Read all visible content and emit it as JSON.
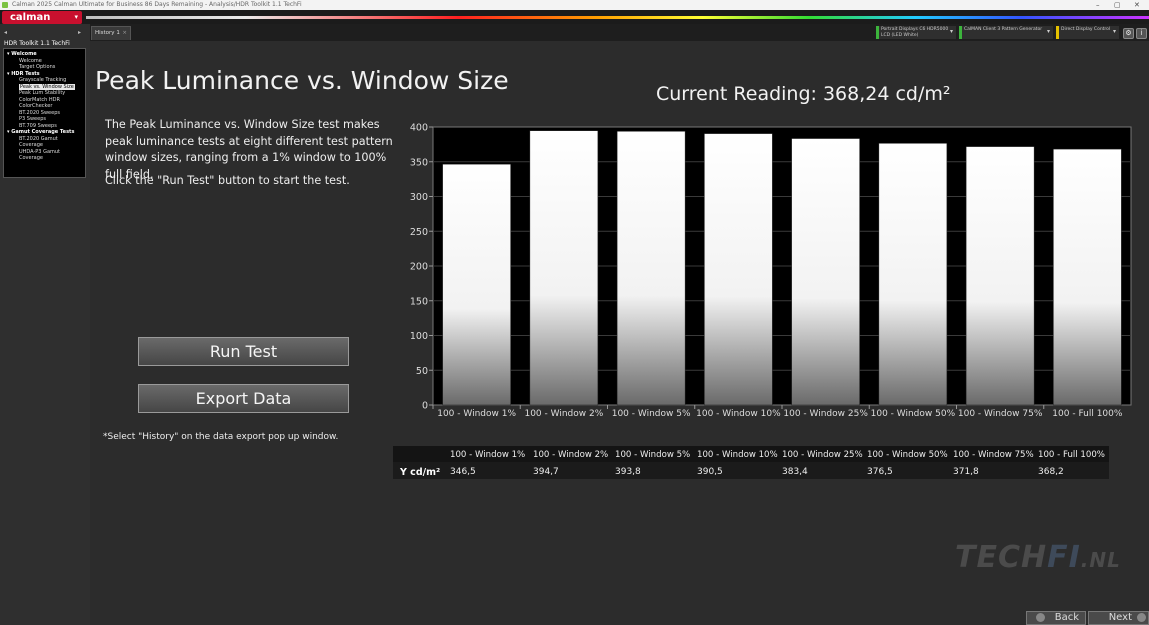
{
  "window": {
    "title": "Calman 2025 Calman Ultimate for Business 86 Days Remaining - Analysis/HDR Toolkit 1.1 TechFi",
    "controls": [
      "–",
      "▢",
      "✕"
    ]
  },
  "app": {
    "logo": "calman",
    "menu_caret": "▾"
  },
  "sidebar": {
    "title": "HDR Toolkit 1.1 TechFi",
    "nav_left": "◂",
    "nav_right": "▸",
    "tree": [
      {
        "label": "Welcome",
        "level": 0
      },
      {
        "label": "Welcome",
        "level": 1
      },
      {
        "label": "Target Options",
        "level": 1
      },
      {
        "label": "HDR Tests",
        "level": 0
      },
      {
        "label": "Grayscale Tracking",
        "level": 1
      },
      {
        "label": "Peak vs. Window Size",
        "level": 1,
        "selected": true
      },
      {
        "label": "Peak Lum Stability",
        "level": 1
      },
      {
        "label": "ColorMatch HDR",
        "level": 1
      },
      {
        "label": "ColorChecker",
        "level": 1
      },
      {
        "label": "BT.2020 Sweeps",
        "level": 1
      },
      {
        "label": "P3 Sweeps",
        "level": 1
      },
      {
        "label": "BT.709 Sweeps",
        "level": 1
      },
      {
        "label": "Gamut Coverage Tests",
        "level": 0
      },
      {
        "label": "BT.2020 Gamut Coverage",
        "level": 1
      },
      {
        "label": "UHDA-P3 Gamut Coverage",
        "level": 1
      }
    ]
  },
  "tabs": {
    "history_label": "History 1",
    "close": "×"
  },
  "devices": {
    "meter": "Portrait Displays C6 HDR5000 LCD (LED White)",
    "generator": "CalMAN Client 3 Pattern Generator",
    "display": "Direct Display Control"
  },
  "main": {
    "title": "Peak Luminance vs. Window Size",
    "current_reading": "Current Reading: 368,24 cd/m²",
    "description": "The Peak Luminance vs. Window Size test makes peak luminance tests at eight different test pattern window sizes, ranging from a 1% window to 100% full field.",
    "instruction": "Click the \"Run Test\" button to start the test.",
    "run_button": "Run Test",
    "export_button": "Export  Data",
    "note": "*Select \"History\" on the data export pop up window."
  },
  "chart_data": {
    "type": "bar",
    "categories": [
      "100 - Window  1%",
      "100 - Window  2%",
      "100 - Window  5%",
      "100 - Window 10%",
      "100 - Window 25%",
      "100 - Window 50%",
      "100 - Window 75%",
      "100 - Full  100%"
    ],
    "values": [
      346.5,
      394.7,
      393.8,
      390.5,
      383.4,
      376.5,
      371.8,
      368.2
    ],
    "ylim": [
      0,
      400
    ],
    "yticks": [
      "0",
      "50",
      "100",
      "150",
      "200",
      "250",
      "300",
      "350",
      "400"
    ],
    "bar_color_top": "#ffffff",
    "bar_color_bottom": "#6a6a6a",
    "plot_background": "#000000"
  },
  "table": {
    "row_label": "Y cd/m²",
    "headers": [
      "100 - Window  1%",
      "100 - Window  2%",
      "100 - Window  5%",
      "100 - Window 10%",
      "100 - Window 25%",
      "100 - Window 50%",
      "100 - Window 75%",
      "100 - Full  100%"
    ],
    "values": [
      "346,5",
      "394,7",
      "393,8",
      "390,5",
      "383,4",
      "376,5",
      "371,8",
      "368,2"
    ]
  },
  "watermark": {
    "part1": "TECH",
    "part2": "FI",
    "part3": ".NL"
  },
  "nav": {
    "back": "Back",
    "next": "Next"
  }
}
